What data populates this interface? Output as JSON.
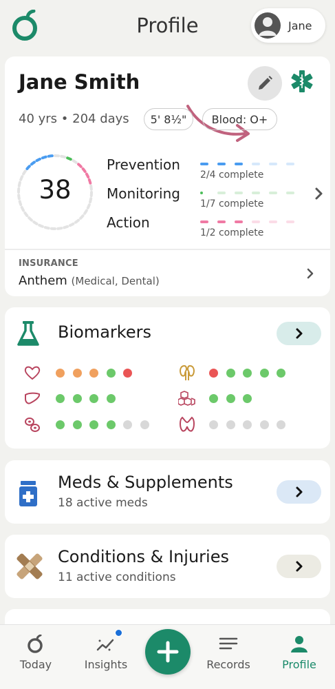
{
  "header": {
    "title": "Profile",
    "user_name": "Jane",
    "icons": [
      "app-logo",
      "avatar-icon"
    ]
  },
  "profile": {
    "name": "Jane Smith",
    "age": "40 yrs • 204 days",
    "height": "5' 8½\"",
    "blood": "Blood: O+",
    "icons": [
      "edit-icon",
      "medical-star-icon"
    ],
    "score": "38",
    "goals": [
      {
        "label": "Prevention",
        "status": "2/4 complete",
        "done": 2,
        "total": 4,
        "color": "#4a9cf0",
        "light": "#d6e8fb"
      },
      {
        "label": "Monitoring",
        "status": "1/7 complete",
        "done": 1,
        "total": 7,
        "color": "#4cbe5a",
        "light": "#d8efd9"
      },
      {
        "label": "Action",
        "status": "1/2 complete",
        "done": 1,
        "total": 2,
        "color": "#f07aa4",
        "light": "#fbdce7"
      }
    ]
  },
  "insurance": {
    "label": "INSURANCE",
    "provider": "Anthem",
    "coverage": "(Medical, Dental)"
  },
  "biomarkers": {
    "title": "Biomarkers",
    "icon": "flask-icon",
    "button_color": "#d8ecea",
    "rows": [
      {
        "icon": "heart-icon",
        "dots": [
          "#f0a05e",
          "#f0a05e",
          "#f0a05e",
          "#6cc96a",
          "#ea5555"
        ]
      },
      {
        "icon": "kidney-icon",
        "dots": [
          "#ea5555",
          "#6cc96a",
          "#6cc96a",
          "#6cc96a",
          "#6cc96a"
        ]
      },
      {
        "icon": "liver-icon",
        "dots": [
          "#6cc96a",
          "#6cc96a",
          "#6cc96a",
          "#6cc96a"
        ]
      },
      {
        "icon": "metabolic-cubes-icon",
        "dots": [
          "#6cc96a",
          "#6cc96a",
          "#6cc96a"
        ]
      },
      {
        "icon": "blood-cells-icon",
        "dots": [
          "#6cc96a",
          "#6cc96a",
          "#6cc96a",
          "#6cc96a",
          "#d8d8d8",
          "#d8d8d8"
        ]
      },
      {
        "icon": "thyroid-icon",
        "dots": [
          "#d8d8d8",
          "#d8d8d8",
          "#d8d8d8",
          "#d8d8d8",
          "#d8d8d8"
        ]
      }
    ]
  },
  "meds": {
    "title": "Meds & Supplements",
    "subtitle": "18 active meds",
    "icon": "pill-bottle-icon",
    "button_color": "#dbe8f6"
  },
  "conditions": {
    "title": "Conditions & Injuries",
    "subtitle": "11 active conditions",
    "icon": "bandage-icon",
    "button_color": "#ecebe3"
  },
  "nav": {
    "items": [
      {
        "label": "Today",
        "icon": "today-icon"
      },
      {
        "label": "Insights",
        "icon": "insights-icon"
      },
      {
        "label": "Records",
        "icon": "records-icon"
      },
      {
        "label": "Profile",
        "icon": "profile-icon"
      }
    ],
    "add_icon": "plus-icon",
    "active": "Profile",
    "accent": "#1c8a69"
  }
}
